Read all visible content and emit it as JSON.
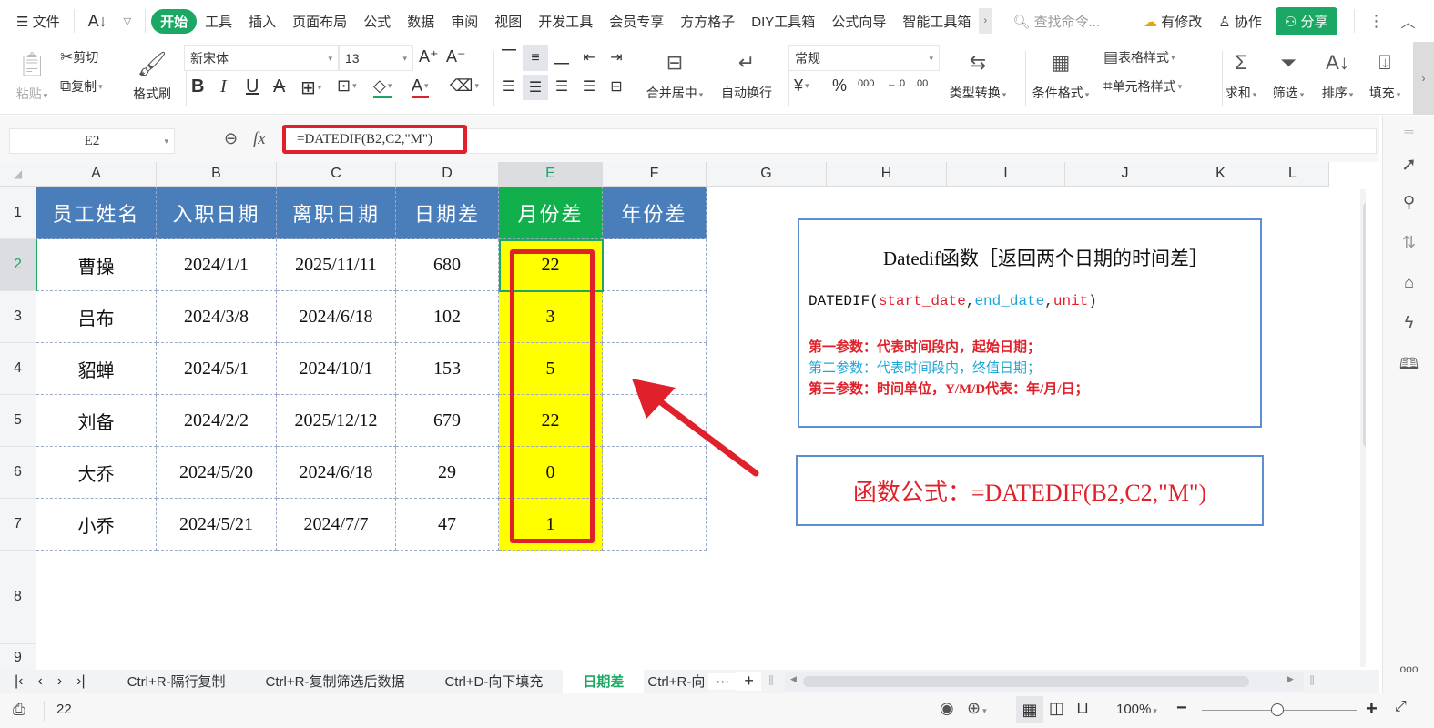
{
  "menubar": {
    "file_label": "文件",
    "tabs": [
      "开始",
      "工具",
      "插入",
      "页面布局",
      "公式",
      "数据",
      "审阅",
      "视图",
      "开发工具",
      "会员专享",
      "方方格子",
      "DIY工具箱",
      "公式向导",
      "智能工具箱",
      "subscription"
    ],
    "active_tab": "开始",
    "search_placeholder": "查找命令...",
    "modified_label": "有修改",
    "collab_label": "协作",
    "share_label": "分享"
  },
  "ribbon": {
    "paste": "粘贴",
    "cut": "剪切",
    "copy": "复制",
    "format_painter": "格式刷",
    "font_name": "新宋体",
    "font_size": "13",
    "merge_center": "合并居中",
    "wrap_text": "自动换行",
    "number_format": "常规",
    "type_convert": "类型转换",
    "conditional_format": "条件格式",
    "table_style": "表格样式",
    "cell_style": "单元格样式",
    "sum": "求和",
    "filter": "筛选",
    "sort": "排序",
    "fill": "填充"
  },
  "formula_bar": {
    "cell_ref": "E2",
    "fx_label": "fx",
    "formula": "=DATEDIF(B2,C2,\"M\")"
  },
  "columns": [
    "A",
    "B",
    "C",
    "D",
    "E",
    "F",
    "G",
    "H",
    "I",
    "J",
    "K",
    "L"
  ],
  "rows": [
    "1",
    "2",
    "3",
    "4",
    "5",
    "6",
    "7",
    "8",
    "9"
  ],
  "selected_cell": "E2",
  "table": {
    "headers": [
      "员工姓名",
      "入职日期",
      "离职日期",
      "日期差",
      "月份差",
      "年份差"
    ],
    "rows": [
      [
        "曹操",
        "2024/1/1",
        "2025/11/11",
        "680",
        "22",
        ""
      ],
      [
        "吕布",
        "2024/3/8",
        "2024/6/18",
        "102",
        "3",
        ""
      ],
      [
        "貂蝉",
        "2024/5/1",
        "2024/10/1",
        "153",
        "5",
        ""
      ],
      [
        "刘备",
        "2024/2/2",
        "2025/12/12",
        "679",
        "22",
        ""
      ],
      [
        "大乔",
        "2024/5/20",
        "2024/6/18",
        "29",
        "0",
        ""
      ],
      [
        "小乔",
        "2024/5/21",
        "2024/7/7",
        "47",
        "1",
        ""
      ]
    ]
  },
  "info_box": {
    "title": "Datedif函数［返回两个日期的时间差］",
    "syntax_prefix": "DATEDIF(",
    "syntax_arg1": "start_date",
    "syntax_sep1": ",",
    "syntax_arg2": "end_date",
    "syntax_sep2": ",",
    "syntax_arg3": "unit",
    "syntax_suffix": ")",
    "line1": "第一参数：代表时间段内，起始日期；",
    "line2": "第二参数：代表时间段内，终值日期；",
    "line3": "第三参数：时间单位，Y/M/D代表：年/月/日；"
  },
  "formula_box": {
    "text": "函数公式：=DATEDIF(B2,C2,\"M\")"
  },
  "sheet_tabs": [
    "Ctrl+R-隔行复制",
    "Ctrl+R-复制筛选后数据",
    "Ctrl+D-向下填充",
    "日期差",
    "Ctrl+R-向"
  ],
  "active_sheet": "日期差",
  "status": {
    "value": "22",
    "zoom": "100%"
  },
  "colors": {
    "accent": "#1aa864",
    "header_blue": "#4a7ebb",
    "header_green": "#12b04d",
    "highlight_yellow": "#ffff00",
    "annotation_red": "#e0202a"
  }
}
